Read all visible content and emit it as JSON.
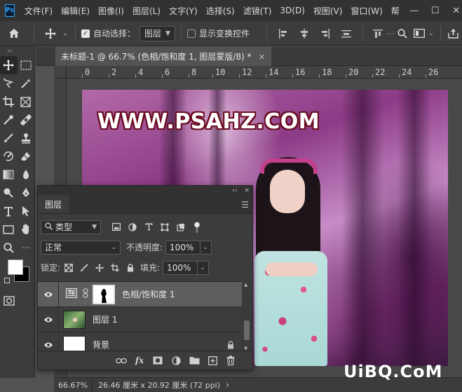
{
  "app": {
    "logo": "Ps",
    "menu": [
      "文件(F)",
      "编辑(E)",
      "图像(I)",
      "图层(L)",
      "文字(Y)",
      "选择(S)",
      "滤镜(T)",
      "3D(D)",
      "视图(V)",
      "窗口(W)",
      "帮"
    ],
    "window_buttons": [
      "—",
      "☐",
      "✕"
    ]
  },
  "options_bar": {
    "auto_select_label": "自动选择：",
    "auto_select_checked": true,
    "auto_select_target": "图层",
    "show_transform_label": "显示变换控件",
    "show_transform_checked": false
  },
  "document": {
    "tab_title": "未标题-1 @ 66.7% (色相/饱和度 1, 图层蒙版/8) *",
    "tab_close": "×",
    "ruler_ticks": [
      "0",
      "2",
      "4",
      "6",
      "8",
      "10",
      "12",
      "14",
      "16",
      "18",
      "20",
      "22",
      "24",
      "26"
    ],
    "watermark_text": "WWW.PSAHZ.COM"
  },
  "layers_panel": {
    "collapse_label": "‹‹",
    "close_label": "×",
    "tab_label": "图层",
    "filter_label": "类型",
    "blend_mode": "正常",
    "opacity_label": "不透明度:",
    "opacity_value": "100%",
    "lock_label": "锁定:",
    "fill_label": "填充:",
    "fill_value": "100%",
    "layers": [
      {
        "name": "色相/饱和度 1",
        "type": "adjustment",
        "selected": true
      },
      {
        "name": "图层 1",
        "type": "image",
        "selected": false
      },
      {
        "name": "背景",
        "type": "background",
        "selected": false,
        "locked": true
      }
    ],
    "bottom_fx_label": "fx"
  },
  "status_bar": {
    "zoom": "66.67%",
    "doc_info": "26.46 厘米 x 20.92 厘米 (72 ppi)",
    "arrow": "›"
  },
  "corner_watermark": "UiBQ.CoM"
}
